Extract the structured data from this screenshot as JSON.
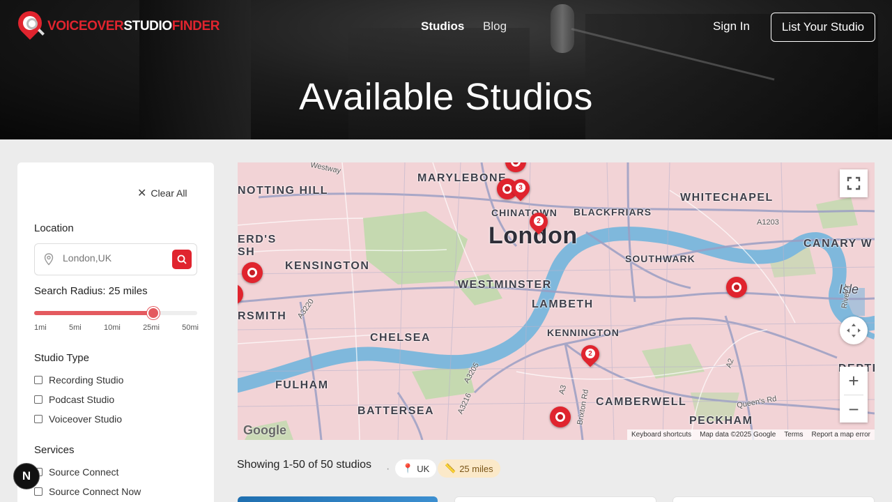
{
  "header": {
    "logo_part1": "VOICEOVER",
    "logo_part2": "STUDIO",
    "logo_part3": "FINDER",
    "nav_studios": "Studios",
    "nav_blog": "Blog",
    "sign_in": "Sign In",
    "list_studio": "List Your Studio",
    "title": "Available Studios"
  },
  "sidebar": {
    "clear_all": "Clear All",
    "location_label": "Location",
    "location_placeholder": "London,UK",
    "radius_label": "Search Radius: 25 miles",
    "radius_value_fraction": 0.73,
    "radius_ticks": [
      "1mi",
      "5mi",
      "10mi",
      "25mi",
      "50mi"
    ],
    "studio_type_label": "Studio Type",
    "studio_types": [
      "Recording Studio",
      "Podcast Studio",
      "Voiceover Studio"
    ],
    "services_label": "Services",
    "services": [
      "Source Connect",
      "Source Connect Now"
    ]
  },
  "map": {
    "labels": {
      "notting_hill": "NOTTING HILL",
      "marylebone": "MARYLEBONE",
      "chinatown": "CHINATOWN",
      "blackfriars": "BLACKFRIARS",
      "whitechapel": "WHITECHAPEL",
      "london": "London",
      "canary": "CANARY W",
      "kensington": "KENSINGTON",
      "southwark": "SOUTHWARK",
      "westminster": "WESTMINSTER",
      "lambeth": "LAMBETH",
      "isle": "Isle",
      "ards": "ERD'S",
      "sh": "SH",
      "rsmith": "RSMITH",
      "chelsea": "CHELSEA",
      "kennington": "KENNINGTON",
      "fulham": "FULHAM",
      "battersea": "BATTERSEA",
      "camberwell": "CAMBERWELL",
      "peckham": "PECKHAM",
      "deptf": "DEPTF",
      "westway": "Westway",
      "a1203": "A1203",
      "a3220": "A3220",
      "a3205": "A3205",
      "a3216": "A3216",
      "a3": "A3",
      "brixton": "Brixton Rd",
      "queens": "Queen's Rd",
      "a2": "A2",
      "river": "River T"
    },
    "cluster_counts": [
      "3",
      "2",
      "2"
    ],
    "google": "Google",
    "attribution": [
      "Keyboard shortcuts",
      "Map data ©2025 Google",
      "Terms",
      "Report a map error"
    ]
  },
  "results": {
    "showing": "Showing 1-50 of 50 studios",
    "separator": "·",
    "badge_country": "UK",
    "badge_radius": "25 miles"
  },
  "dev_badge": "N",
  "colors": {
    "brand_red": "#e0242e",
    "slider": "#e45a5f",
    "map_bg": "#f2d3d6",
    "river": "#7fb8dc",
    "park": "#b9dba6"
  }
}
